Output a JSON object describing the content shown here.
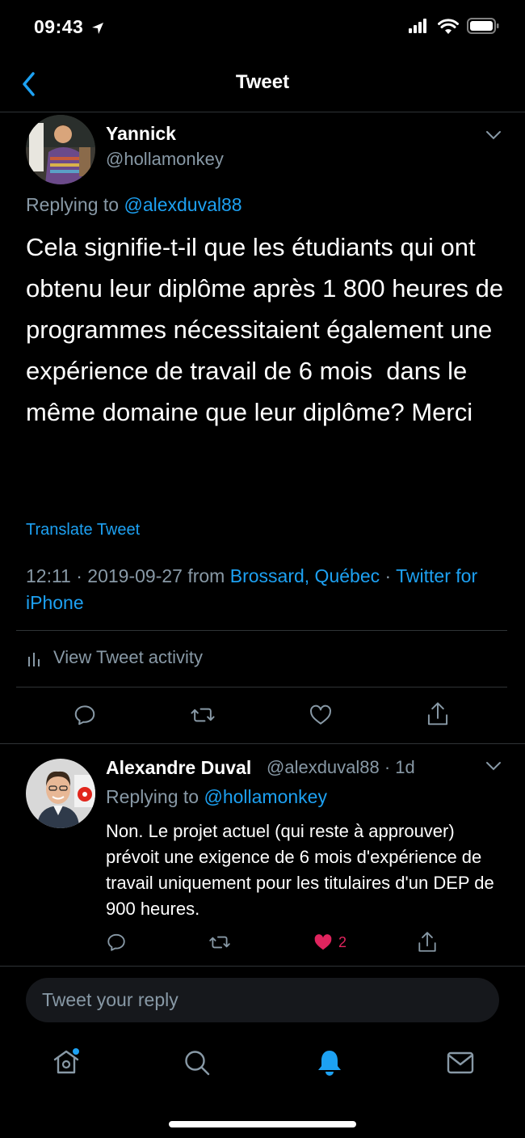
{
  "status_bar": {
    "time": "09:43"
  },
  "nav": {
    "title": "Tweet"
  },
  "main_tweet": {
    "author_name": "Yannick",
    "author_handle": "@hollamonkey",
    "replying_prefix": "Replying to ",
    "replying_to": "@alexduval88",
    "text": "Cela signifie-t-il que les étudiants qui ont obtenu leur diplôme après 1 800 heures de programmes nécessitaient également une expérience de travail de 6 mois  dans le même domaine que leur diplôme? Merci",
    "translate_label": "Translate Tweet",
    "timestamp": "12:11 · 2019-09-27 from ",
    "location": "Brossard, Québec",
    "separator": " · ",
    "source": "Twitter for iPhone",
    "activity_label": "View Tweet activity"
  },
  "reply_tweet": {
    "author_name": "Alexandre Duval",
    "author_handle": "@alexduval88 · 1d",
    "replying_prefix": "Replying to ",
    "replying_to": "@hollamonkey",
    "text": "Non. Le projet actuel (qui reste à approuver) prévoit une exigence de 6 mois d'expérience de travail uniquement pour les titulaires d'un DEP de 900 heures.",
    "like_count": "2"
  },
  "composer": {
    "placeholder": "Tweet your reply"
  },
  "tab_bar": {
    "items": [
      {
        "icon": "home-icon",
        "active": false
      },
      {
        "icon": "search-icon",
        "active": false
      },
      {
        "icon": "notifications-icon",
        "active": true
      },
      {
        "icon": "messages-icon",
        "active": false
      }
    ]
  },
  "colors": {
    "accent": "#1da1f2",
    "like": "#e0245e",
    "muted": "#8899a6",
    "background": "#000000"
  }
}
